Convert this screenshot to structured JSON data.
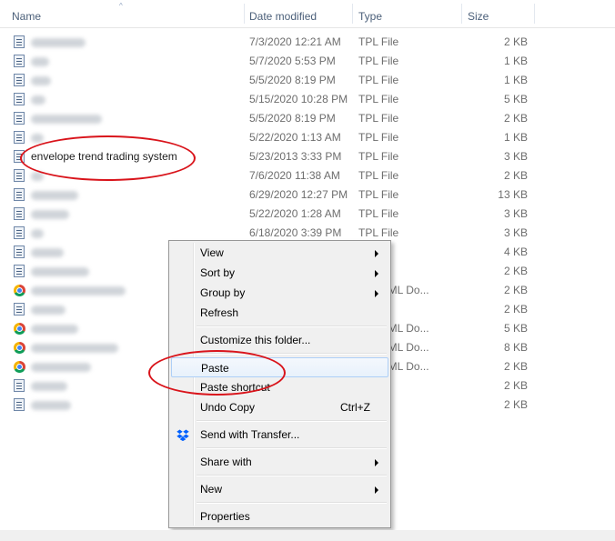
{
  "columns": {
    "name": "Name",
    "date": "Date modified",
    "type": "Type",
    "size": "Size"
  },
  "files": [
    {
      "name": "",
      "blur_w": 60,
      "icon": "text-file-icon",
      "date": "7/3/2020 12:21 AM",
      "type": "TPL File",
      "size": "2 KB"
    },
    {
      "name": "",
      "blur_w": 20,
      "icon": "text-file-icon",
      "date": "5/7/2020 5:53 PM",
      "type": "TPL File",
      "size": "1 KB"
    },
    {
      "name": "",
      "blur_w": 22,
      "icon": "text-file-icon",
      "date": "5/5/2020 8:19 PM",
      "type": "TPL File",
      "size": "1 KB"
    },
    {
      "name": "",
      "blur_w": 16,
      "icon": "text-file-icon",
      "date": "5/15/2020 10:28 PM",
      "type": "TPL File",
      "size": "5 KB"
    },
    {
      "name": "",
      "blur_w": 78,
      "icon": "text-file-icon",
      "date": "5/5/2020 8:19 PM",
      "type": "TPL File",
      "size": "2 KB"
    },
    {
      "name": "",
      "blur_w": 14,
      "icon": "text-file-icon",
      "date": "5/22/2020 1:13 AM",
      "type": "TPL File",
      "size": "1 KB"
    },
    {
      "name": "envelope trend trading system",
      "blur_w": 0,
      "icon": "text-file-icon",
      "date": "5/23/2013 3:33 PM",
      "type": "TPL File",
      "size": "3 KB"
    },
    {
      "name": "",
      "blur_w": 14,
      "icon": "text-file-icon",
      "date": "7/6/2020 11:38 AM",
      "type": "TPL File",
      "size": "2 KB"
    },
    {
      "name": "",
      "blur_w": 52,
      "icon": "text-file-icon",
      "date": "6/29/2020 12:27 PM",
      "type": "TPL File",
      "size": "13 KB"
    },
    {
      "name": "",
      "blur_w": 42,
      "icon": "text-file-icon",
      "date": "5/22/2020 1:28 AM",
      "type": "TPL File",
      "size": "3 KB"
    },
    {
      "name": "",
      "blur_w": 14,
      "icon": "text-file-icon",
      "date": "6/18/2020 3:39 PM",
      "type": "TPL File",
      "size": "3 KB"
    },
    {
      "name": "",
      "blur_w": 36,
      "icon": "text-file-icon",
      "date": "",
      "type": "",
      "size": "4 KB"
    },
    {
      "name": "",
      "blur_w": 64,
      "icon": "text-file-icon",
      "date": "",
      "type": "",
      "size": "2 KB"
    },
    {
      "name": "",
      "blur_w": 104,
      "icon": "chrome-icon",
      "date": "",
      "type": "ne HTML Do...",
      "size": "2 KB"
    },
    {
      "name": "",
      "blur_w": 38,
      "icon": "text-file-icon",
      "date": "",
      "type": "",
      "size": "2 KB"
    },
    {
      "name": "",
      "blur_w": 52,
      "icon": "chrome-icon",
      "date": "",
      "type": "ne HTML Do...",
      "size": "5 KB"
    },
    {
      "name": "",
      "blur_w": 96,
      "icon": "chrome-icon",
      "date": "",
      "type": "ne HTML Do...",
      "size": "8 KB"
    },
    {
      "name": "",
      "blur_w": 66,
      "icon": "chrome-icon",
      "date": "",
      "type": "ne HTML Do...",
      "size": "2 KB"
    },
    {
      "name": "",
      "blur_w": 40,
      "icon": "text-file-icon",
      "date": "",
      "type": "",
      "size": "2 KB"
    },
    {
      "name": "",
      "blur_w": 44,
      "icon": "text-file-icon",
      "date": "",
      "type": "",
      "size": "2 KB"
    }
  ],
  "context_menu": {
    "items": [
      {
        "label": "View",
        "submenu": true,
        "shortcut": "",
        "icon": ""
      },
      {
        "label": "Sort by",
        "submenu": true,
        "shortcut": "",
        "icon": ""
      },
      {
        "label": "Group by",
        "submenu": true,
        "shortcut": "",
        "icon": ""
      },
      {
        "label": "Refresh",
        "submenu": false,
        "shortcut": "",
        "icon": ""
      },
      {
        "label": "Customize this folder...",
        "submenu": false,
        "shortcut": "",
        "icon": ""
      },
      {
        "label": "Paste",
        "submenu": false,
        "shortcut": "",
        "icon": "",
        "highlighted": true
      },
      {
        "label": "Paste shortcut",
        "submenu": false,
        "shortcut": "",
        "icon": ""
      },
      {
        "label": "Undo Copy",
        "submenu": false,
        "shortcut": "Ctrl+Z",
        "icon": ""
      },
      {
        "label": "Send with Transfer...",
        "submenu": false,
        "shortcut": "",
        "icon": "dropbox-icon"
      },
      {
        "label": "Share with",
        "submenu": true,
        "shortcut": "",
        "icon": ""
      },
      {
        "label": "New",
        "submenu": true,
        "shortcut": "",
        "icon": ""
      },
      {
        "label": "Properties",
        "submenu": false,
        "shortcut": "",
        "icon": ""
      }
    ]
  },
  "colors": {
    "annotation": "#d9141b",
    "header_text": "#4c607a",
    "menu_bg": "#f0f0f0",
    "dropbox": "#0061fe"
  }
}
